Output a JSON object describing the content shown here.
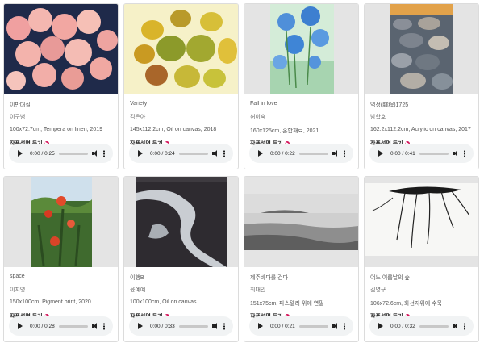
{
  "listen_label": "작품설명 듣기",
  "cards": [
    {
      "title": "이만대실",
      "artist": "이구범",
      "spec": "100x72.7cm, Tempera on linen, 2019",
      "time": "0:00 / 0:25"
    },
    {
      "title": "Variety",
      "artist": "김은아",
      "spec": "145x112.2cm, Oil on canvas, 2018",
      "time": "0:00 / 0:24"
    },
    {
      "title": "Fall in love",
      "artist": "허이숙",
      "spec": "160x125cm, 혼합재료, 2021",
      "time": "0:00 / 0:22"
    },
    {
      "title": "역정(驛程)1725",
      "artist": "남학호",
      "spec": "162.2x112.2cm, Acrylic on canvas, 2017",
      "time": "0:00 / 0:41"
    },
    {
      "title": "space",
      "artist": "이지영",
      "spec": "150x100cm, Pigment print, 2020",
      "time": "0:00 / 0:28"
    },
    {
      "title": "이행B",
      "artist": "윤예예",
      "spec": "100x100cm, Oil on canvas",
      "time": "0:00 / 0:33"
    },
    {
      "title": "제주바다를 걷다",
      "artist": "최대인",
      "spec": "151x75cm, 파스텔리 위에 연필",
      "time": "0:00 / 0:21"
    },
    {
      "title": "어느 여름날의 숲",
      "artist": "김영구",
      "spec": "106x72.6cm, 화선지위에 수묵",
      "time": "0:00 / 0:32"
    }
  ]
}
